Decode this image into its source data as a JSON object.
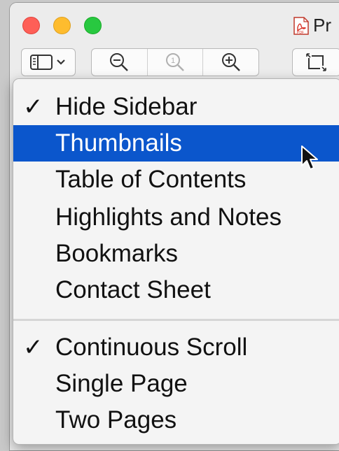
{
  "window": {
    "title": "Pr",
    "traffic_lights": [
      "close",
      "minimize",
      "zoom"
    ],
    "document_icon": "pdf-document-icon",
    "document_icon_label": "PDF"
  },
  "toolbar": {
    "sidebar_button_icon": "sidebar-icon",
    "zoom_out_icon": "zoom-out-icon",
    "actual_size_icon": "actual-size-icon",
    "zoom_in_icon": "zoom-in-icon",
    "crop_icon": "crop-icon"
  },
  "menu": {
    "items": [
      {
        "label": "Hide Sidebar",
        "checked": true,
        "selected": false
      },
      {
        "label": "Thumbnails",
        "checked": false,
        "selected": true
      },
      {
        "label": "Table of Contents",
        "checked": false,
        "selected": false
      },
      {
        "label": "Highlights and Notes",
        "checked": false,
        "selected": false
      },
      {
        "label": "Bookmarks",
        "checked": false,
        "selected": false
      },
      {
        "label": "Contact Sheet",
        "checked": false,
        "selected": false
      },
      {
        "label": "Continuous Scroll",
        "checked": true,
        "selected": false
      },
      {
        "label": "Single Page",
        "checked": false,
        "selected": false
      },
      {
        "label": "Two Pages",
        "checked": false,
        "selected": false
      }
    ],
    "check_glyph": "✓"
  },
  "colors": {
    "selection": "#0b56cc",
    "close": "#fe5f57",
    "minimize": "#febc2e",
    "zoom": "#28c840",
    "pdf_red": "#d93025"
  }
}
